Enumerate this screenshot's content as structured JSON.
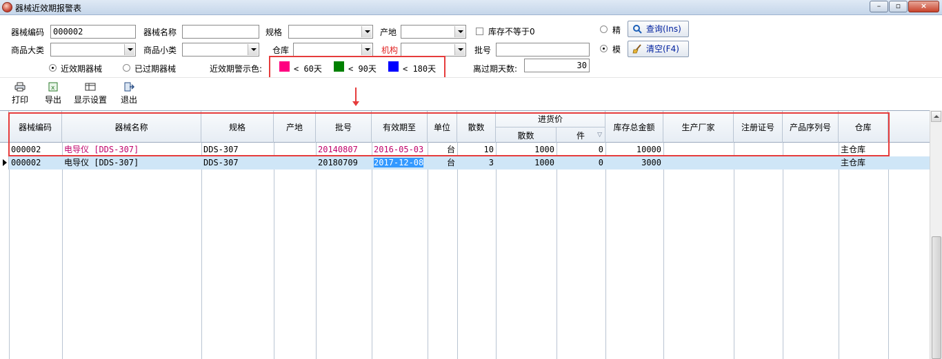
{
  "window": {
    "title": "器械近效期报警表",
    "minimize": "–",
    "restore": "▫",
    "close": "×"
  },
  "filters": {
    "device_code_label": "器械编码",
    "device_code_value": "000002",
    "device_name_label": "器械名称",
    "device_name_value": "",
    "spec_label": "规格",
    "origin_label": "产地",
    "stock_not_equal_zero_label": "库存不等于0",
    "category_label": "商品大类",
    "subcategory_label": "商品小类",
    "warehouse_label": "仓库",
    "org_label": "机构",
    "batch_label": "批号",
    "batch_value": "",
    "near_expiry_label": "近效期器械",
    "expired_label": "已过期器械",
    "warning_color_label": "近效期警示色:",
    "days_to_expiry_label": "离过期天数:",
    "days_to_expiry_value": "30",
    "exact_label": "精",
    "fuzzy_label": "模",
    "query_button": "查询(Ins)",
    "clear_button": "清空(F4)"
  },
  "legend": [
    {
      "label": "< 60天",
      "color": "#ff0080"
    },
    {
      "label": "< 90天",
      "color": "#008000"
    },
    {
      "label": "< 180天",
      "color": "#0000ff"
    }
  ],
  "toolbar": {
    "print": "打印",
    "export": "导出",
    "display_settings": "显示设置",
    "exit": "退出"
  },
  "grid": {
    "headers": {
      "code": "器械编码",
      "name": "器械名称",
      "spec": "规格",
      "origin": "产地",
      "batch": "批号",
      "expiry": "有效期至",
      "unit": "单位",
      "qty": "散数",
      "purchase_price": "进货价",
      "price_loose": "散数",
      "price_piece": "件",
      "total_amount": "库存总金额",
      "manufacturer": "生产厂家",
      "reg_no": "注册证号",
      "serial": "产品序列号",
      "warehouse": "仓库"
    },
    "rows": [
      {
        "code": "000002",
        "name": "电导仪 [DDS-307]",
        "spec": "DDS-307",
        "origin": "",
        "batch": "20140807",
        "expiry": "2016-05-03",
        "unit": "台",
        "qty": "10",
        "price_loose": "1000",
        "price_piece": "0",
        "total_amount": "10000",
        "manufacturer": "",
        "reg_no": "",
        "serial": "",
        "warehouse": "主仓库"
      },
      {
        "code": "000002",
        "name": "电导仪 [DDS-307]",
        "spec": "DDS-307",
        "origin": "",
        "batch": "20180709",
        "expiry": "2017-12-08",
        "unit": "台",
        "qty": "3",
        "price_loose": "1000",
        "price_piece": "0",
        "total_amount": "3000",
        "manufacturer": "",
        "reg_no": "",
        "serial": "",
        "warehouse": "主仓库"
      }
    ]
  },
  "colors": {
    "highlight_pink": "#c0006a",
    "selection_blue": "#3399ff",
    "row_selected": "#cfe6f7",
    "annotation_red": "#e63b3b"
  }
}
